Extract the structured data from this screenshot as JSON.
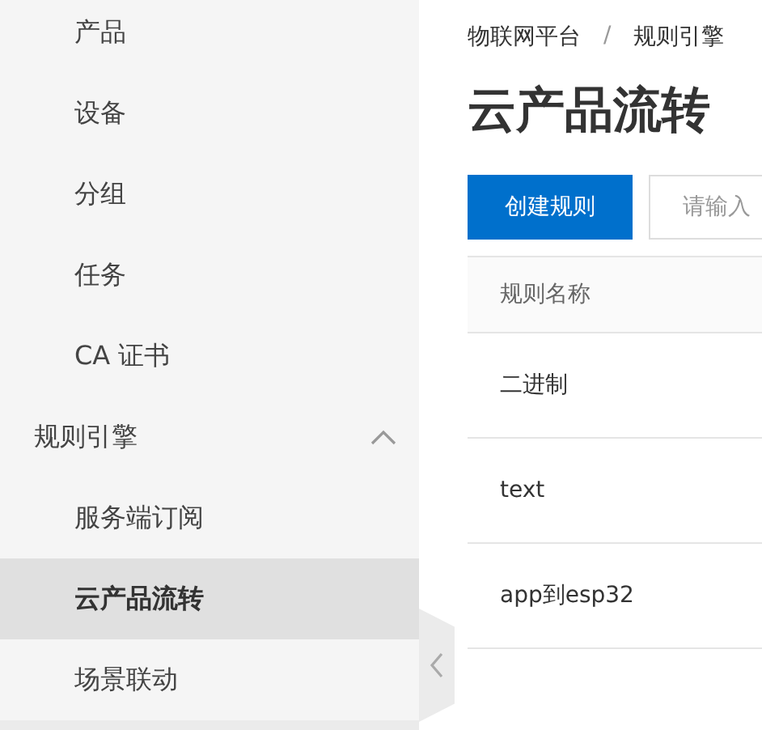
{
  "sidebar": {
    "items": [
      {
        "label": "产品",
        "selected": false
      },
      {
        "label": "设备",
        "selected": false
      },
      {
        "label": "分组",
        "selected": false
      },
      {
        "label": "任务",
        "selected": false
      },
      {
        "label": "CA 证书",
        "selected": false
      },
      {
        "label": "规则引擎",
        "selected": false,
        "expanded": true,
        "children": [
          {
            "label": "服务端订阅",
            "selected": false
          },
          {
            "label": "云产品流转",
            "selected": true
          },
          {
            "label": "场景联动",
            "selected": false
          }
        ]
      }
    ]
  },
  "breadcrumb": [
    "物联网平台",
    "规则引擎"
  ],
  "breadcrumb_separator": "/",
  "page_title": "云产品流转",
  "create_button": "创建规则",
  "search": {
    "placeholder": "请输入"
  },
  "table": {
    "columns": [
      "规则名称"
    ],
    "rows": [
      [
        "二进制"
      ],
      [
        "text"
      ],
      [
        "app到esp32"
      ]
    ]
  }
}
